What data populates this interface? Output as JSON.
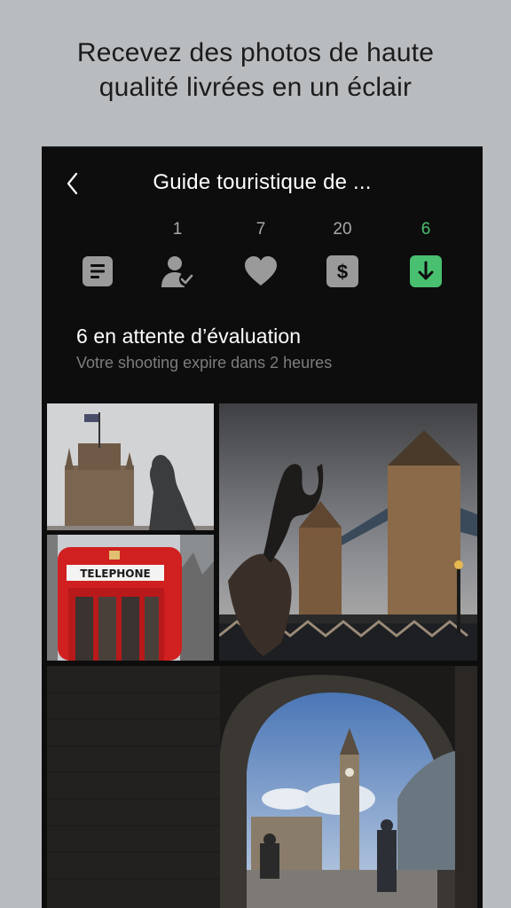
{
  "promo": {
    "line1": "Recevez des photos de haute",
    "line2": "qualité livrées en un éclair"
  },
  "header": {
    "title": "Guide touristique de ..."
  },
  "stats": [
    {
      "icon": "list-icon",
      "count": ""
    },
    {
      "icon": "user-check-icon",
      "count": "1"
    },
    {
      "icon": "heart-icon",
      "count": "7"
    },
    {
      "icon": "dollar-icon",
      "count": "20"
    },
    {
      "icon": "download-icon",
      "count": "6",
      "active": true
    }
  ],
  "pending": {
    "heading": "6 en attente d’évaluation",
    "subtext": "Votre shooting expire dans 2 heures"
  },
  "photos": {
    "telephone_sign": "TELEPHONE"
  },
  "colors": {
    "background": "#b9bcbf",
    "panel": "#0d0d0d",
    "accent": "#49c070",
    "icon_gray": "#9a9a9a"
  }
}
